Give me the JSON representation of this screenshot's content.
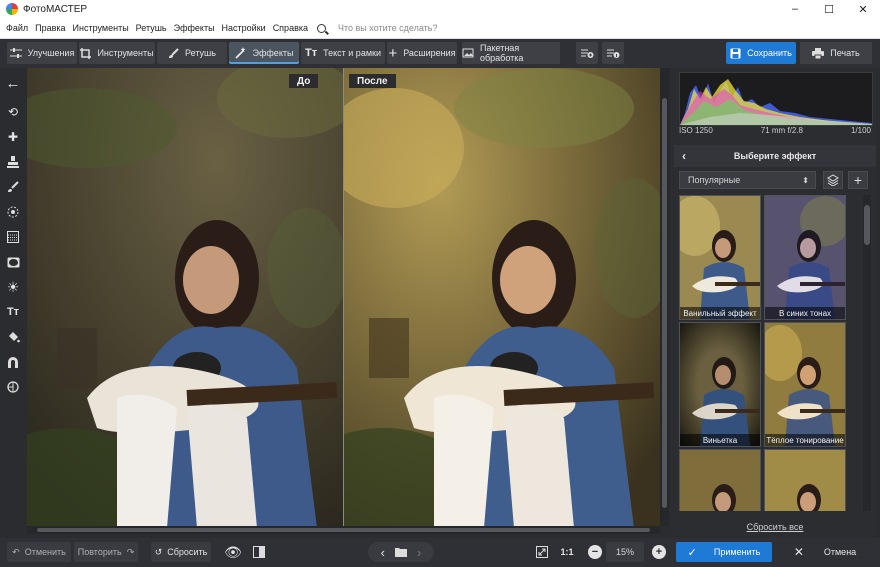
{
  "window": {
    "title": "ФотоМАСТЕР",
    "minimize": "–",
    "maximize": "☐",
    "close": "✕"
  },
  "menu": {
    "items": [
      "Файл",
      "Правка",
      "Инструменты",
      "Ретушь",
      "Эффекты",
      "Настройки",
      "Справка"
    ],
    "search_placeholder": "Что вы хотите сделать?"
  },
  "toolbar": {
    "tabs": [
      {
        "label": "Улучшения",
        "icon": "sliders-icon"
      },
      {
        "label": "Инструменты",
        "icon": "crop-icon"
      },
      {
        "label": "Ретушь",
        "icon": "brush-icon"
      },
      {
        "label": "Эффекты",
        "icon": "magic-wand-icon"
      },
      {
        "label": "Текст и рамки",
        "icon": "text-icon"
      },
      {
        "label": "Расширения",
        "icon": "plus-icon"
      },
      {
        "label": "Пакетная обработка",
        "icon": "image-stack-icon"
      }
    ],
    "active_tab": "Эффекты",
    "save_label": "Сохранить",
    "print_label": "Печать"
  },
  "canvas": {
    "before_label": "До",
    "after_label": "После"
  },
  "histogram": {
    "iso": "ISO 1250",
    "lens": "71 mm f/2.8",
    "shutter": "1/100"
  },
  "effects_panel": {
    "title": "Выберите эффект",
    "category": "Популярные",
    "thumbnails": [
      {
        "label": "Ванильный эффект",
        "tint": "#8a7a48"
      },
      {
        "label": "В синих тонах",
        "tint": "#5a5470"
      },
      {
        "label": "Виньетка",
        "tint": "#4a4530"
      },
      {
        "label": "Тёплое тонирование",
        "tint": "#8c7a40"
      },
      {
        "label": "",
        "tint": "#7a6a3a"
      },
      {
        "label": "",
        "tint": "#6e6238"
      }
    ],
    "reset_all": "Сбросить все"
  },
  "bottom": {
    "undo": "Отменить",
    "redo": "Повторить",
    "reset": "Сбросить",
    "ratio": "1:1",
    "zoom": "15%",
    "apply": "Применить",
    "cancel": "Отмена"
  },
  "colors": {
    "accent": "#1f7ad6",
    "panel": "#2c2d31",
    "background": "#2b2c30"
  }
}
